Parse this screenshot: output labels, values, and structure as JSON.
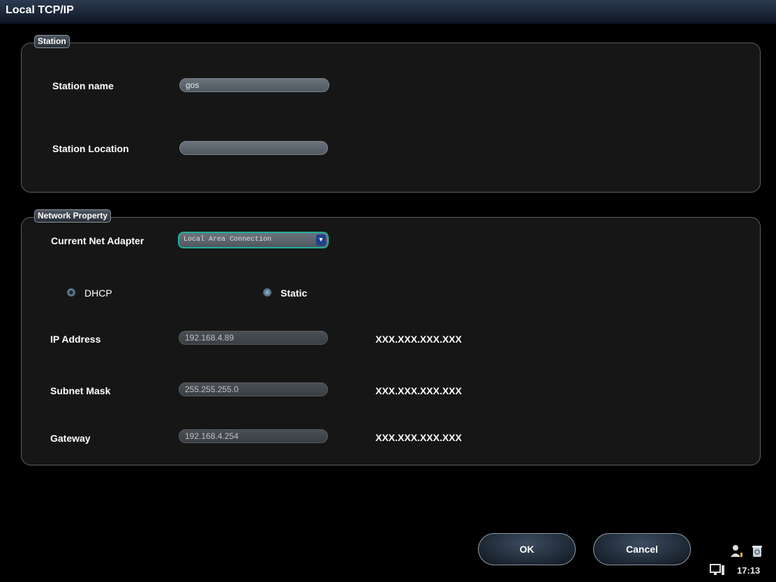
{
  "window": {
    "title": "Local TCP/IP"
  },
  "station": {
    "legend": "Station",
    "name_label": "Station name",
    "name_value": "gos",
    "location_label": "Station Location",
    "location_value": ""
  },
  "network": {
    "legend": "Network Property",
    "adapter_label": "Current Net Adapter",
    "adapter_value": "Local Area Connection",
    "dhcp_label": "DHCP",
    "static_label": "Static",
    "ip_label": "IP Address",
    "ip_value": "192.168.4.89",
    "ip_hint": "XXX.XXX.XXX.XXX",
    "subnet_label": "Subnet Mask",
    "subnet_value": "255.255.255.0",
    "subnet_hint": "XXX.XXX.XXX.XXX",
    "gateway_label": "Gateway",
    "gateway_value": "192.168.4.254",
    "gateway_hint": "XXX.XXX.XXX.XXX",
    "selected_mode": "DHCP"
  },
  "buttons": {
    "ok": "OK",
    "cancel": "Cancel"
  },
  "tray": {
    "time": "17:13",
    "icons": [
      "user-icon",
      "recycle-bin-icon",
      "monitor-icon"
    ]
  },
  "colors": {
    "focus_accent": "#1fae9c",
    "title_bar": "#1c2a3c"
  }
}
